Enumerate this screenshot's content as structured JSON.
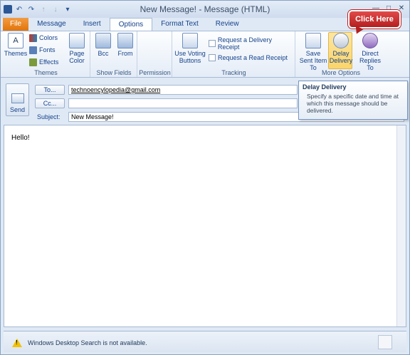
{
  "window": {
    "title": "New Message! - Message (HTML)"
  },
  "tabs": [
    "File",
    "Message",
    "Insert",
    "Options",
    "Format Text",
    "Review"
  ],
  "ribbon": {
    "themes_group": {
      "label": "Themes",
      "themes": "Themes",
      "colors": "Colors",
      "fonts": "Fonts",
      "effects": "Effects",
      "page_color": "Page Color"
    },
    "show_fields_group": {
      "label": "Show Fields",
      "bcc": "Bcc",
      "from": "From"
    },
    "permission_group": {
      "label": "Permission"
    },
    "tracking_group": {
      "label": "Tracking",
      "voting": "Use Voting Buttons",
      "delivery_receipt": "Request a Delivery Receipt",
      "read_receipt": "Request a Read Receipt"
    },
    "more_options_group": {
      "label": "More Options",
      "save_sent": "Save Sent Item To",
      "delay": "Delay Delivery",
      "direct": "Direct Replies To"
    }
  },
  "callout": "Click Here",
  "tooltip": {
    "title": "Delay Delivery",
    "text": "Specify a specific date and time at which this message should be delivered."
  },
  "header": {
    "send": "Send",
    "to_btn": "To...",
    "cc_btn": "Cc...",
    "subject_label": "Subject:",
    "to": "technoencylopedia@gmail.com",
    "cc": "",
    "subject": "New Message!"
  },
  "body": {
    "text": "Hello!"
  },
  "status": {
    "text": "Windows Desktop Search is not available."
  }
}
